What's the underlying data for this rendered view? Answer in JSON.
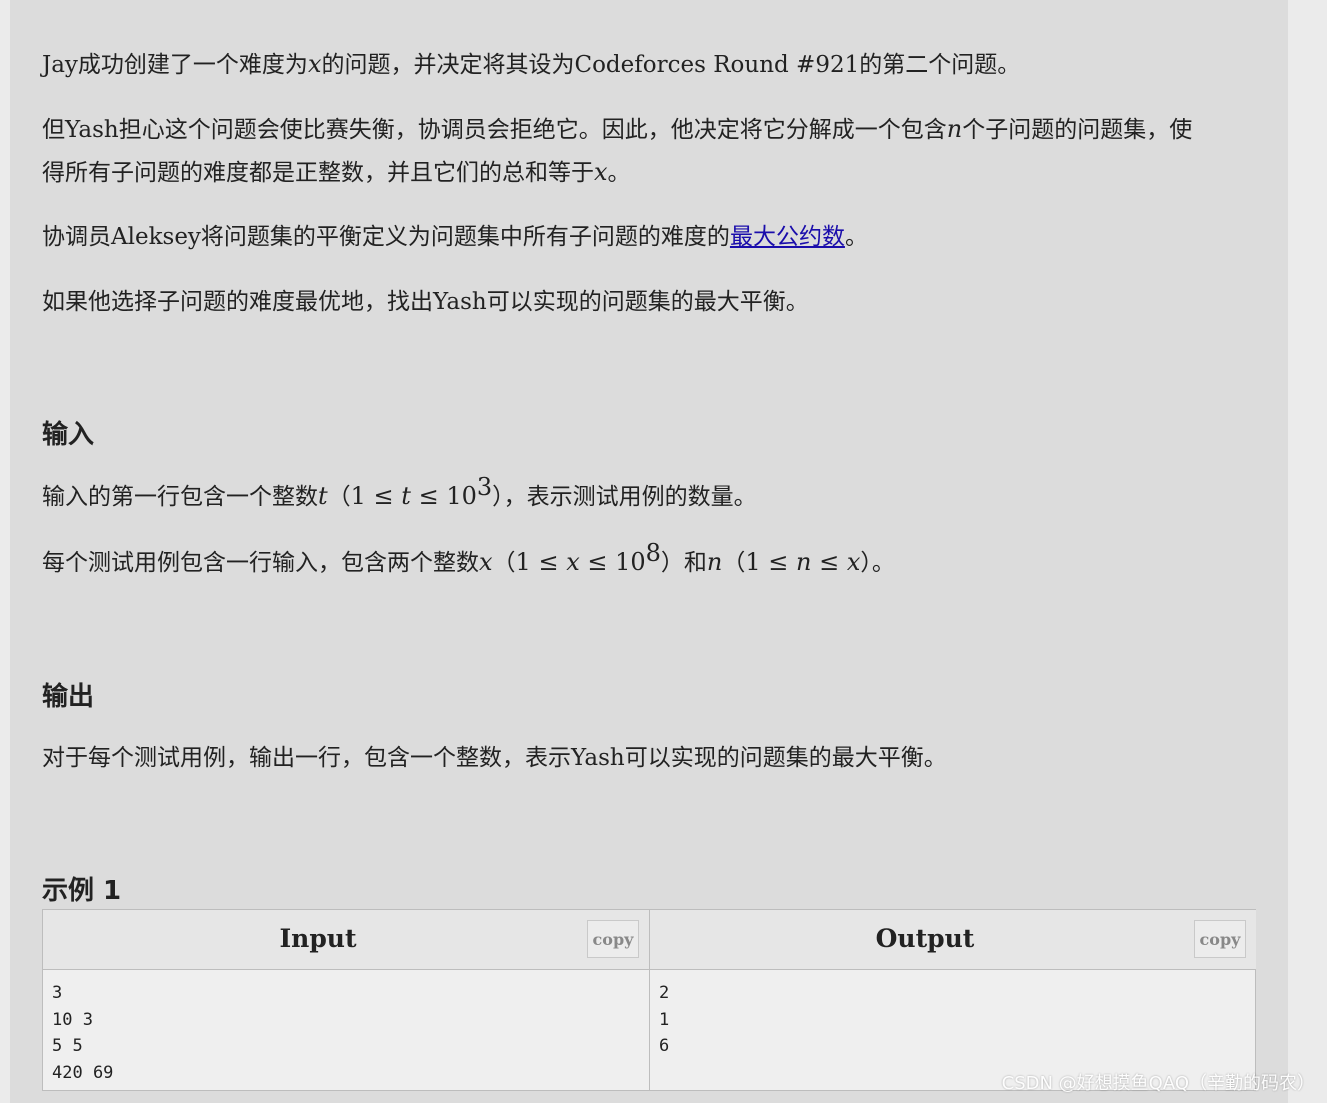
{
  "statement": {
    "p1": {
      "a": "Jay成功创建了一个难度为",
      "x": "x",
      "b": "的问题，并决定将其设为Codeforces Round #921的第二个问题。"
    },
    "p2": {
      "a": "但Yash担心这个问题会使比赛失衡，协调员会拒绝它。因此，他决定将它分解成一个包含",
      "n": "n",
      "b": "个子问题的问题集，使",
      "c": "得所有子问题的难度都是正整数，并且它们的总和等于",
      "x": "x",
      "d": "。"
    },
    "p3": {
      "a": "协调员Aleksey将问题集的平衡定义为问题集中所有子问题的难度的",
      "link": "最大公约数",
      "b": "。"
    },
    "p4": "如果他选择子问题的难度最优地，找出Yash可以实现的问题集的最大平衡。"
  },
  "input_section": {
    "heading": "输入",
    "line1": {
      "a": "输入的第一行包含一个整数",
      "t": "t",
      "open": "（",
      "one": "1 ≤ ",
      "t2": "t",
      "le": " ≤ 10",
      "exp": "3",
      "close": "），表示测试用例的数量。"
    },
    "line2": {
      "a": "每个测试用例包含一行输入，包含两个整数",
      "x": "x",
      "open": "（",
      "one": "1 ≤ ",
      "x2": "x",
      "le": " ≤ 10",
      "exp": "8",
      "mid": "）和",
      "n": "n",
      "open2": "（",
      "one2": "1 ≤ ",
      "n2": "n",
      "le2": " ≤ ",
      "x3": "x",
      "close": "）。"
    }
  },
  "output_section": {
    "heading": "输出",
    "text": "对于每个测试用例，输出一行，包含一个整数，表示Yash可以实现的问题集的最大平衡。"
  },
  "example": {
    "heading": "示例 1",
    "input_title": "Input",
    "output_title": "Output",
    "copy_label": "copy",
    "input_lines": [
      "3",
      "10 3",
      "5 5",
      "420 69"
    ],
    "output_lines": [
      "2",
      "1",
      "6"
    ]
  },
  "watermark": "CSDN @好想摸鱼QAQ（辛勤的码农）"
}
